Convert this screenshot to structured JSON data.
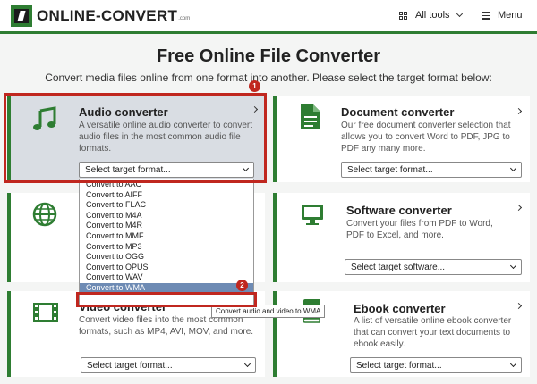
{
  "header": {
    "logo_text": "ONLINE-CONVERT",
    "logo_tld": ".com",
    "all_tools_label": "All tools",
    "menu_label": "Menu"
  },
  "page": {
    "title": "Free Online File Converter",
    "subtitle": "Convert media files online from one format into another. Please select the target format below:"
  },
  "cards": {
    "audio": {
      "title": "Audio converter",
      "description": "A versatile online audio converter to convert audio files in the most common audio file formats.",
      "select_value": "Select target format..."
    },
    "document": {
      "title": "Document converter",
      "description": "Our free document converter selection that allows you to convert Word to PDF, JPG to PDF any many more.",
      "select_value": "Select target format..."
    },
    "software": {
      "title": "Software converter",
      "description": "Convert your files from PDF to Word, PDF to Excel, and more.",
      "select_value": "Select target software..."
    },
    "video": {
      "title": "Video converter",
      "description": "Convert video files into the most common formats, such as MP4, AVI, MOV, and more.",
      "select_value": "Select target format..."
    },
    "ebook": {
      "title": "Ebook converter",
      "description": "A list of versatile online ebook converter that can convert your text documents to ebook easily.",
      "select_value": "Select target format..."
    }
  },
  "dropdown": {
    "options": [
      "Convert to AAC",
      "Convert to AIFF",
      "Convert to FLAC",
      "Convert to M4A",
      "Convert to M4R",
      "Convert to MMF",
      "Convert to MP3",
      "Convert to OGG",
      "Convert to OPUS",
      "Convert to WAV",
      "Convert to WMA"
    ],
    "highlighted_index": 10
  },
  "tooltip": "Convert audio and video to WMA",
  "annotations": {
    "badge_1": "1",
    "badge_2": "2"
  },
  "colors": {
    "brand_green": "#2e7d32",
    "annotation_red": "#c0271f",
    "option_highlight": "#6e8bb4"
  },
  "icons": [
    "music-note-icon",
    "document-icon",
    "globe-icon",
    "monitor-icon",
    "film-icon",
    "book-icon"
  ]
}
